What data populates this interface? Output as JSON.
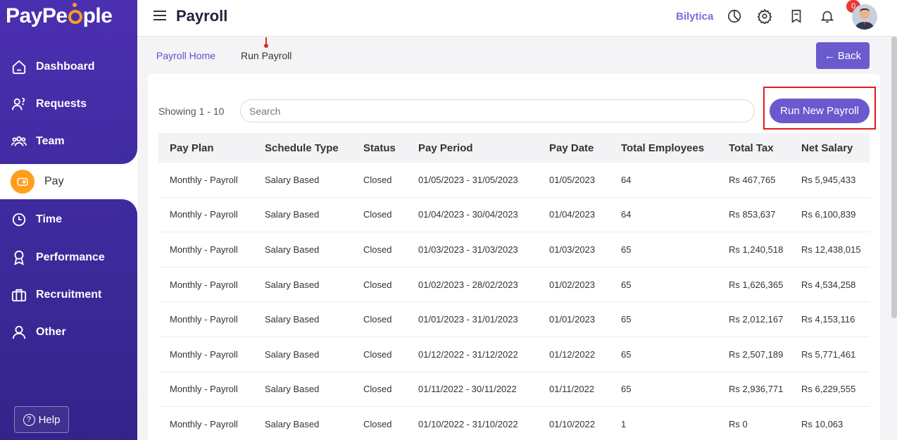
{
  "app": {
    "logo": {
      "left": "PayPe",
      "right": "ple"
    },
    "help_label": "Help"
  },
  "sidebar": {
    "items": [
      {
        "label": "Dashboard",
        "icon": "home-icon"
      },
      {
        "label": "Requests",
        "icon": "requests-icon"
      },
      {
        "label": "Team",
        "icon": "team-icon"
      },
      {
        "label": "Pay",
        "icon": "pay-icon",
        "active": true
      },
      {
        "label": "Time",
        "icon": "clock-icon"
      },
      {
        "label": "Performance",
        "icon": "award-icon"
      },
      {
        "label": "Recruitment",
        "icon": "briefcase-icon"
      },
      {
        "label": "Other",
        "icon": "user-icon"
      }
    ]
  },
  "header": {
    "title": "Payroll",
    "brand_link": "Bilytica",
    "notification_count": "0"
  },
  "breadcrumb": {
    "home": "Payroll Home",
    "current": "Run Payroll"
  },
  "actions": {
    "back_label": "Back",
    "run_new_label": "Run New Payroll"
  },
  "list": {
    "showing": "Showing 1 - 10",
    "search_placeholder": "Search"
  },
  "table": {
    "columns": [
      "Pay Plan",
      "Schedule Type",
      "Status",
      "Pay Period",
      "Pay Date",
      "Total Employees",
      "Total Tax",
      "Net Salary"
    ],
    "rows": [
      [
        "Monthly - Payroll",
        "Salary Based",
        "Closed",
        "01/05/2023 - 31/05/2023",
        "01/05/2023",
        "64",
        "Rs 467,765",
        "Rs 5,945,433"
      ],
      [
        "Monthly - Payroll",
        "Salary Based",
        "Closed",
        "01/04/2023 - 30/04/2023",
        "01/04/2023",
        "64",
        "Rs 853,637",
        "Rs 6,100,839"
      ],
      [
        "Monthly - Payroll",
        "Salary Based",
        "Closed",
        "01/03/2023 - 31/03/2023",
        "01/03/2023",
        "65",
        "Rs 1,240,518",
        "Rs 12,438,015"
      ],
      [
        "Monthly - Payroll",
        "Salary Based",
        "Closed",
        "01/02/2023 - 28/02/2023",
        "01/02/2023",
        "65",
        "Rs 1,626,365",
        "Rs 4,534,258"
      ],
      [
        "Monthly - Payroll",
        "Salary Based",
        "Closed",
        "01/01/2023 - 31/01/2023",
        "01/01/2023",
        "65",
        "Rs 2,012,167",
        "Rs 4,153,116"
      ],
      [
        "Monthly - Payroll",
        "Salary Based",
        "Closed",
        "01/12/2022 - 31/12/2022",
        "01/12/2022",
        "65",
        "Rs 2,507,189",
        "Rs 5,771,461"
      ],
      [
        "Monthly - Payroll",
        "Salary Based",
        "Closed",
        "01/11/2022 - 30/11/2022",
        "01/11/2022",
        "65",
        "Rs 2,936,771",
        "Rs 6,229,555"
      ],
      [
        "Monthly - Payroll",
        "Salary Based",
        "Closed",
        "01/10/2022 - 31/10/2022",
        "01/10/2022",
        "1",
        "Rs 0",
        "Rs 10,063"
      ]
    ]
  },
  "colors": {
    "sidebar": "#4b2fb0",
    "accent": "#6a5acd",
    "pay_icon": "#ff9e1b",
    "highlight": "#e31b1b"
  }
}
